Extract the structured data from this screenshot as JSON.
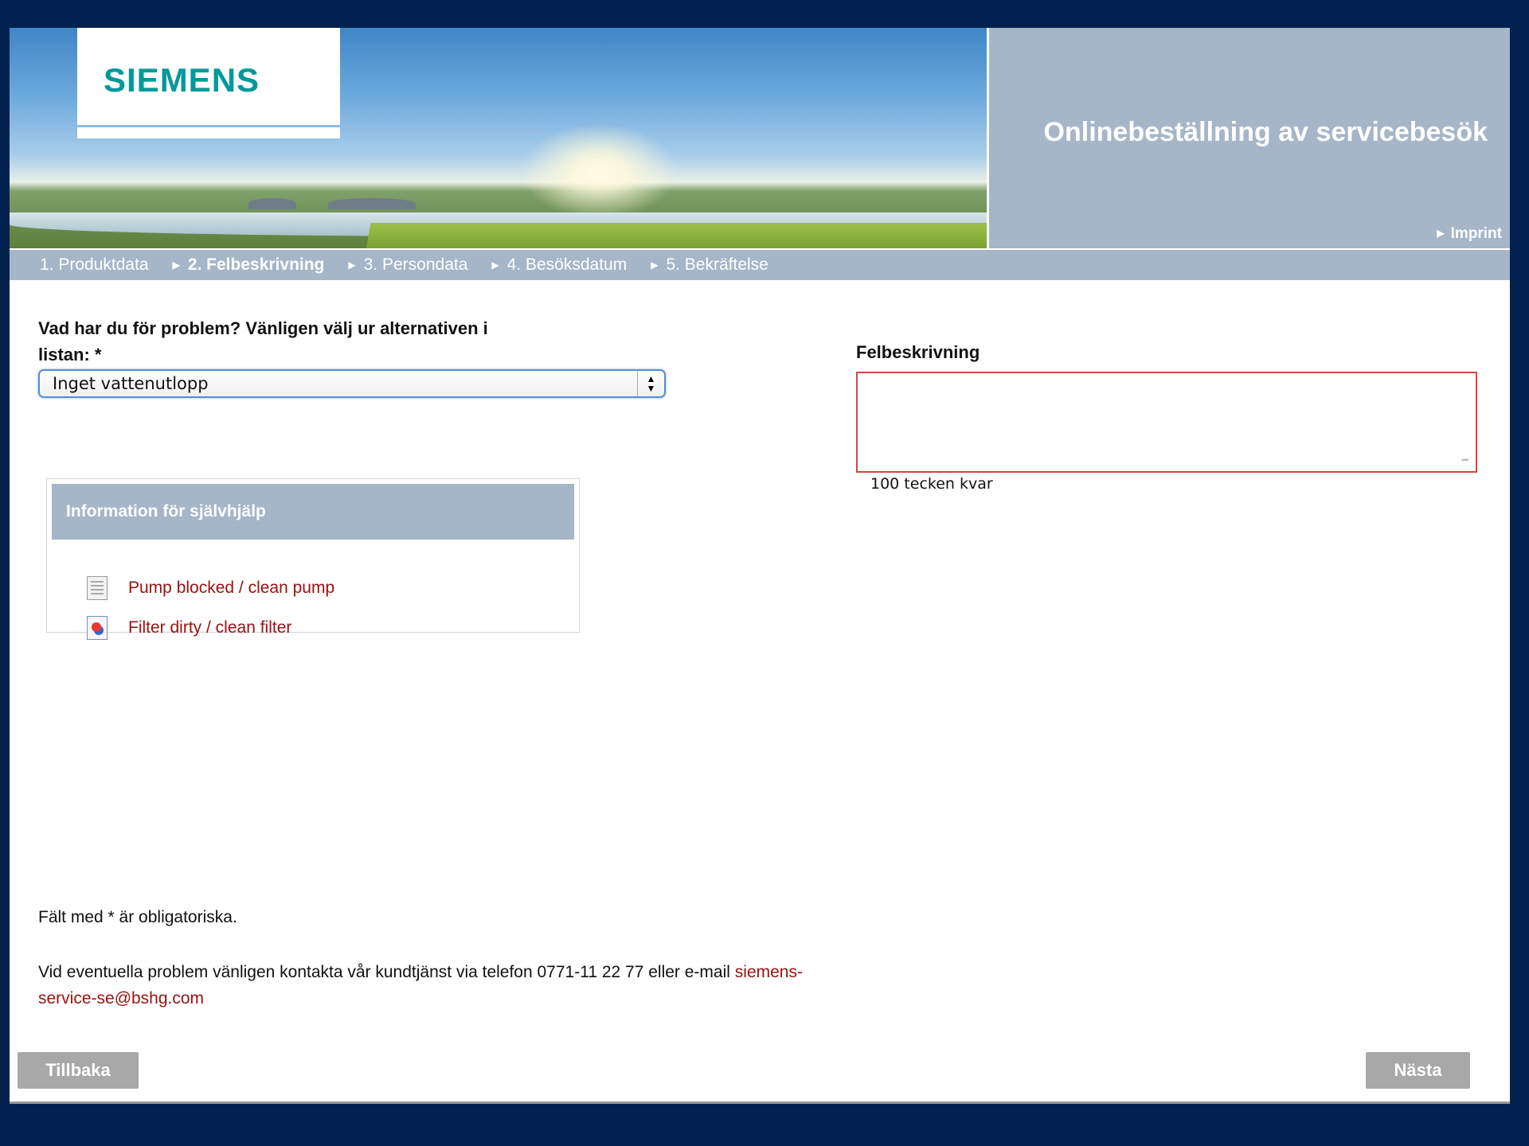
{
  "header": {
    "logo_text": "SIEMENS",
    "title": "Onlinebeställning av servicebesök",
    "imprint_label": "Imprint"
  },
  "steps": [
    {
      "label": "1. Produktdata",
      "active": false
    },
    {
      "label": "2. Felbeskrivning",
      "active": true
    },
    {
      "label": "3. Persondata",
      "active": false
    },
    {
      "label": "4. Besöksdatum",
      "active": false
    },
    {
      "label": "5. Bekräftelse",
      "active": false
    }
  ],
  "problem": {
    "label": "Vad har du för problem? Vänligen välj ur alternativen i listan: *",
    "selected": "Inget vattenutlopp"
  },
  "selfhelp": {
    "title": "Information för självhjälp",
    "links": [
      {
        "label": "Pump blocked / clean pump",
        "icon": "document-icon"
      },
      {
        "label": "Filter dirty / clean filter",
        "icon": "image-file-icon"
      }
    ]
  },
  "description": {
    "label": "Felbeskrivning",
    "value": "",
    "chars_left": "100 tecken kvar"
  },
  "footer": {
    "required_note": "Fält med * är obligatoriska.",
    "contact_text": "Vid eventuella problem vänligen kontakta vår kundtjänst via telefon 0771-11 22 77 eller e-mail",
    "email": "siemens-service-se@bshg.com"
  },
  "buttons": {
    "back": "Tillbaka",
    "next": "Nästa"
  },
  "colors": {
    "brand": "#009999",
    "panel": "#a4b6c8",
    "link": "#9a1010",
    "border_error": "#d04848",
    "frame": "#03214f"
  }
}
